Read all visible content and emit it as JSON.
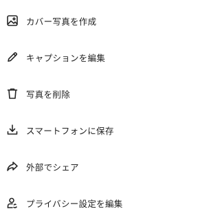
{
  "menu": {
    "items": [
      {
        "label": "カバー写真を作成",
        "icon": "image-icon"
      },
      {
        "label": "キャプションを編集",
        "icon": "pencil-icon"
      },
      {
        "label": "写真を削除",
        "icon": "trash-icon"
      },
      {
        "label": "スマートフォンに保存",
        "icon": "download-icon"
      },
      {
        "label": "外部でシェア",
        "icon": "share-icon"
      },
      {
        "label": "プライバシー設定を編集",
        "icon": "privacy-user-icon"
      }
    ]
  }
}
